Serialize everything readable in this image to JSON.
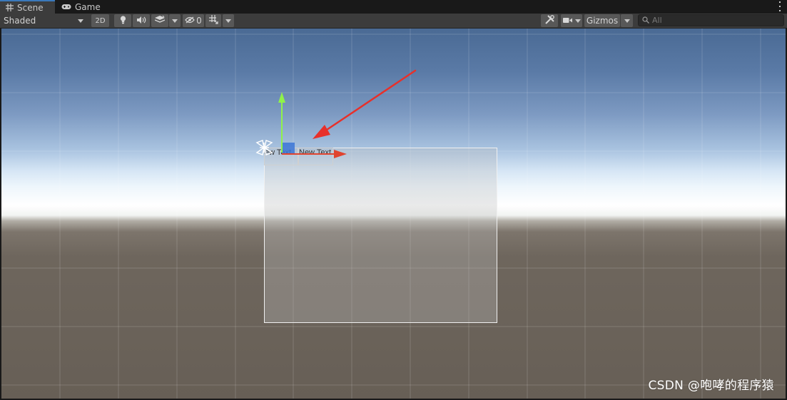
{
  "tabs": [
    {
      "label": "Scene",
      "icon": "grid-icon",
      "active": true
    },
    {
      "label": "Game",
      "icon": "gamepad-icon",
      "active": false
    }
  ],
  "toolbar": {
    "draw_mode": "Shaded",
    "toggle_2d": "2D",
    "hidden_count": "0",
    "gizmos": "Gizmos",
    "search_placeholder": "All"
  },
  "scene": {
    "text_labels": [
      "ew Text",
      "New Text"
    ]
  },
  "colors": {
    "arrow_annotation": "#e8302a",
    "gizmo_y_axis": "#8ff24a",
    "gizmo_x_axis": "#e0432e",
    "gizmo_plane": "#3c76d6",
    "active_tab_indicator": "#3a79bb"
  },
  "watermark": "CSDN @咆哮的程序猿"
}
